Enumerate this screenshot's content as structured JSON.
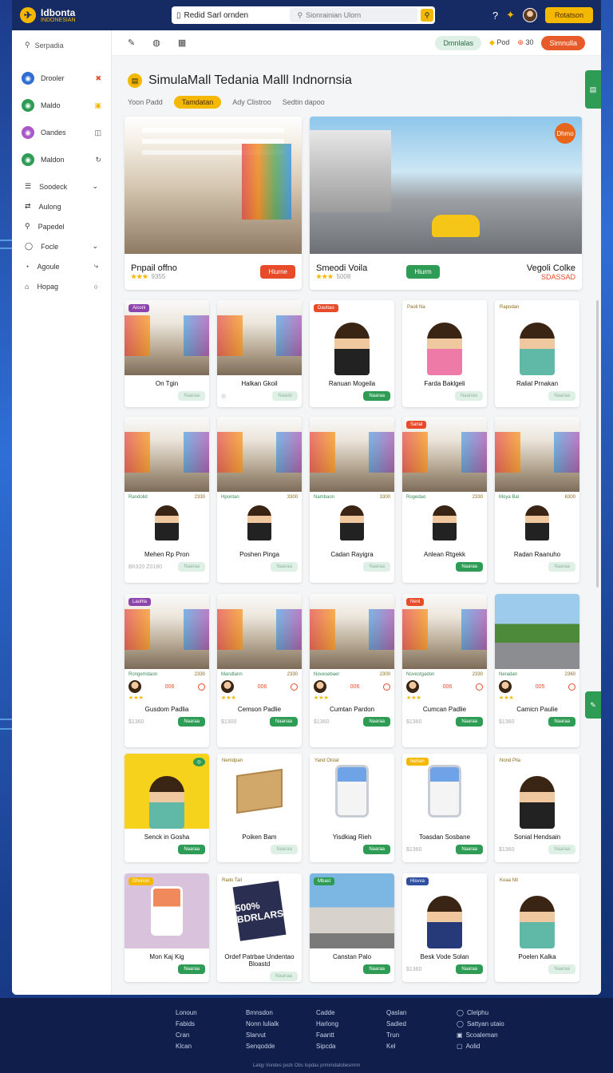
{
  "app": {
    "logo_title": "Idbonta",
    "logo_subtitle": "INDONESIAN"
  },
  "topbar": {
    "search_left": "Redid Sarl ornden",
    "search_placeholder": "Sionrainian Ulorn",
    "cta_label": "Rotatson"
  },
  "sidebar": {
    "search_label": "Serpadia",
    "items": [
      {
        "label": "Drooler",
        "color": "#2f6fd1",
        "tail": "✖",
        "tail_color": "#e84b2a"
      },
      {
        "label": "Maldo",
        "color": "#2e9c55",
        "tail": "▣",
        "tail_color": "#f5b800"
      },
      {
        "label": "Oandes",
        "color": "#a957c9",
        "tail": "◫",
        "tail_color": "#555555"
      },
      {
        "label": "Maldon",
        "color": "#2e9c55",
        "tail": "↻",
        "tail_color": "#555555"
      }
    ],
    "sub_items": [
      {
        "label": "Soodeck",
        "icon": "☰",
        "tail": "⌄"
      },
      {
        "label": "Aulong",
        "icon": "⇄",
        "tail": ""
      },
      {
        "label": "Papedel",
        "icon": "⚲",
        "tail": ""
      },
      {
        "label": "Focle",
        "icon": "◯",
        "tail": "⌄"
      },
      {
        "label": "Agoule",
        "icon": "◔",
        "tail": "⤷"
      },
      {
        "label": "Hopag",
        "icon": "⌂",
        "tail": "○"
      }
    ]
  },
  "toolbar": {
    "green_pill": "Dmnlalas",
    "label_1": "Pod",
    "label_2": "30",
    "red_pill": "Simnulla"
  },
  "page": {
    "title": "SimulaMall Tedania Malll Indnornsia",
    "tabs": [
      "Yoon Padd",
      "Tamdatan",
      "Ady Clistroo",
      "Sedtin dapoo"
    ],
    "active_tab": 1
  },
  "hero": [
    {
      "name": "Pnpail offno",
      "stars": "★★★",
      "rating": "9355",
      "button": "Hiurne",
      "price": "",
      "badge": ""
    },
    {
      "name": "Smeodi Voila",
      "stars": "★★★",
      "rating": "5008",
      "button": "Hiurm",
      "second_name": "Vegoli Colke",
      "price": "SDASSAD",
      "badge": "Dhmo"
    }
  ],
  "rows": [
    [
      {
        "name": "On Tgin",
        "tag": "Aiconi",
        "tag_color": "#8e44ad",
        "button": "Naaraa",
        "btn_style": "faint"
      },
      {
        "name": "Halkan Gkoil",
        "button": "Naado",
        "btn_style": "faint",
        "foot_icon": "◎"
      },
      {
        "name": "Ranuan Mogeila",
        "tag": "Daoltao",
        "tag_color": "#e84b2a",
        "button": "Naaraa",
        "btn_style": "green"
      },
      {
        "name": "Farda Baklgeli",
        "tag_text": "Paoli Na",
        "button": "Naanao",
        "btn_style": "faint"
      },
      {
        "name": "Ralial Prnakan",
        "tag_text": "Rapodan",
        "button": "Naaraa",
        "btn_style": "faint"
      }
    ],
    [
      {
        "name": "Mehen Rp Pron",
        "meta_l": "Randolid",
        "meta_r": "2330",
        "price": "Bh320  Z0180",
        "button": "Naaraa",
        "btn_style": "faint"
      },
      {
        "name": "Poshen Pinga",
        "meta_l": "Hpontan",
        "meta_r": "3300",
        "button": "Naaraa",
        "btn_style": "faint"
      },
      {
        "name": "Cadan Rayigra",
        "meta_l": "Nambaon",
        "meta_r": "3300",
        "button": "Naaraa",
        "btn_style": "faint"
      },
      {
        "name": "Anlean Rtgekk",
        "meta_l": "Rogedao",
        "meta_r": "2330",
        "tag": "Sanal",
        "tag_color": "#e84b2a",
        "button": "Naaraa",
        "btn_style": "green"
      },
      {
        "name": "Radan Raanuho",
        "meta_l": "Moya Bal",
        "meta_r": "6300",
        "button": "Naaraa",
        "btn_style": "faint"
      }
    ],
    [
      {
        "name": "Gusdom Padlia",
        "meta_l": "Rongemdaon",
        "meta_r": "2330",
        "num": "006",
        "tag": "Lauhla",
        "tag_color": "#8e44ad",
        "price": "$1360",
        "button": "Naaraa",
        "btn_style": "green"
      },
      {
        "name": "Cemson Padlie",
        "meta_l": "Mandtann",
        "meta_r": "2330",
        "num": "006",
        "price": "$1300",
        "button": "Naanaa",
        "btn_style": "green"
      },
      {
        "name": "Cumtan Pardon",
        "meta_l": "Novesebaer",
        "meta_r": "2300",
        "num": "006",
        "price": "$1360",
        "button": "Naaraa",
        "btn_style": "green"
      },
      {
        "name": "Cumcan Padlie",
        "meta_l": "Novestgadon",
        "meta_r": "2330",
        "num": "006",
        "tag": "Nenl",
        "tag_color": "#e84b2a",
        "price": "$1360",
        "button": "Naaraa",
        "btn_style": "green"
      },
      {
        "name": "Camicn Paulie",
        "meta_l": "Neradan",
        "meta_r": "2360",
        "num": "005",
        "price": "$1360",
        "button": "Naaraa",
        "btn_style": "green"
      }
    ],
    [
      {
        "name": "Senck in Gosha",
        "button": "Naaraa",
        "btn_style": "green",
        "badge_green": "◎"
      },
      {
        "name": "Poiken Bam",
        "tag_text": "Nemdpan",
        "button": "Naaraa",
        "btn_style": "faint"
      },
      {
        "name": "Yisdkiag Rieh",
        "tag_text": "Yand Olstal",
        "button": "Naaraa",
        "btn_style": "green"
      },
      {
        "name": "Toasdan Sosbane",
        "tag": "Nehan",
        "tag_color": "#f5b800",
        "price": "$1360",
        "button": "Naaraa",
        "btn_style": "green"
      },
      {
        "name": "Sonial Hendsain",
        "tag_text": "Nond Pila",
        "price": "$1360",
        "button": "Naaraa",
        "btn_style": "faint"
      }
    ],
    [
      {
        "name": "Mon Kaj Kig",
        "tag": "Dhonon",
        "tag_color": "#f5b800",
        "button": "Naaraa",
        "btn_style": "green"
      },
      {
        "name": "Ordef Patrbae  Undentao Bloastd",
        "tag_text": "Rado Tail",
        "book_text": "500% BDRLARS",
        "button": "Naanaa",
        "btn_style": "faint"
      },
      {
        "name": "Canstan Palo",
        "tag": "Mbasl",
        "tag_color": "#2e9c55",
        "button": "Naaraa",
        "btn_style": "green"
      },
      {
        "name": "Besk Vode Solan",
        "tag": "Hisvva",
        "tag_color": "#2f4fa1",
        "price": "$1360",
        "button": "Naaraa",
        "btn_style": "green"
      },
      {
        "name": "Poelen Kalka",
        "tag_text": "Koaa Nit",
        "button": "Naaraa",
        "btn_style": "faint"
      }
    ]
  ],
  "footer": {
    "columns": [
      [
        "Lonoun",
        "Fabids",
        "Cran",
        "Klcan"
      ],
      [
        "Bmnsdon",
        "Nonn lulialk",
        "Slarvut",
        "Senqodde"
      ],
      [
        "Cadde",
        "Harlong",
        "Faantt",
        "Sipcda"
      ],
      [
        "Qaslan",
        "Sadied",
        "Trun",
        "Kel"
      ],
      [
        "Clelphu",
        "Sattyan utaio",
        "Scoaleman",
        "Aolid"
      ]
    ],
    "copyright": "Lalqy Vondes pozk Obs Iopdas prmirndalobesmrm"
  }
}
